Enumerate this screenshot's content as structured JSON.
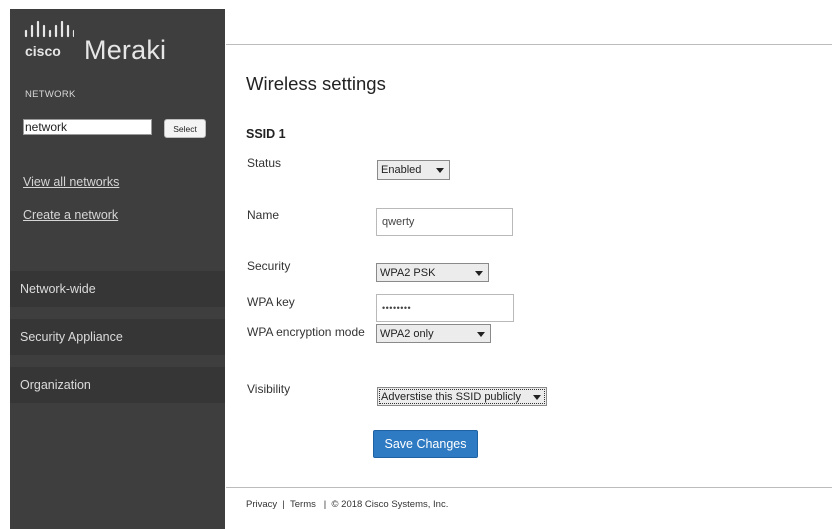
{
  "sidebar": {
    "brand": "Meraki",
    "logo_text": "cisco",
    "network_label": "NETWORK",
    "network_input_value": "network",
    "select_button": "Select",
    "links": {
      "view_all": "View all networks",
      "create": "Create a network"
    },
    "sections": [
      "Network-wide",
      "Security Appliance",
      "Organization"
    ]
  },
  "main": {
    "title": "Wireless settings",
    "ssid_heading": "SSID 1",
    "fields": {
      "status": {
        "label": "Status",
        "value": "Enabled"
      },
      "name": {
        "label": "Name",
        "value": "qwerty"
      },
      "security": {
        "label": "Security",
        "value": "WPA2 PSK"
      },
      "wpa_key": {
        "label": "WPA key",
        "value": "••••••••"
      },
      "wpa_mode": {
        "label": "WPA encryption mode",
        "value": "WPA2 only"
      },
      "visibility": {
        "label": "Visibility",
        "value": "Adverstise this SSID publicly"
      }
    },
    "save_button": "Save Changes"
  },
  "footer": {
    "text": "Privacy  |  Terms   |  © 2018 Cisco Systems, Inc."
  },
  "colors": {
    "sidebar_bg": "#3e3e3e",
    "section_bg": "#363636",
    "primary_button": "#2f7bc3"
  }
}
